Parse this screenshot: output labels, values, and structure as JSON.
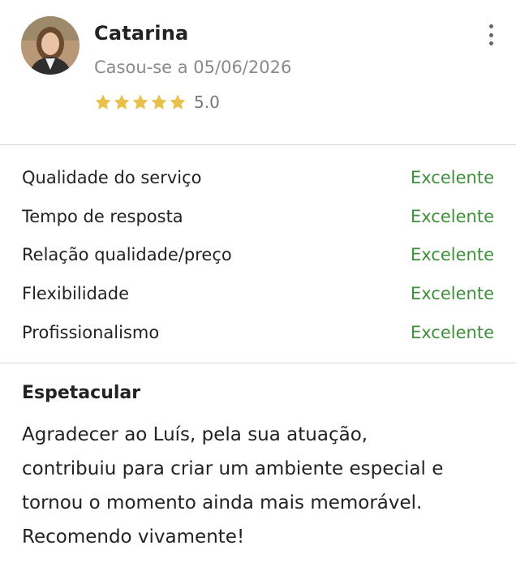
{
  "reviewer": {
    "name": "Catarina",
    "married_text": "Casou-se a 05/06/2026",
    "rating_value": "5.0",
    "stars": 5,
    "star_color": "#e8c04a"
  },
  "criteria": [
    {
      "label": "Qualidade do serviço",
      "value": "Excelente"
    },
    {
      "label": "Tempo de resposta",
      "value": "Excelente"
    },
    {
      "label": "Relação qualidade/preço",
      "value": "Excelente"
    },
    {
      "label": "Flexibilidade",
      "value": "Excelente"
    },
    {
      "label": "Profissionalismo",
      "value": "Excelente"
    }
  ],
  "review": {
    "title": "Espetacular",
    "body": "Agradecer ao Luís, pela sua atuação,\ncontribuiu para criar um ambiente especial e\ntornou o momento ainda mais memorável.\nRecomendo vivamente!"
  },
  "colors": {
    "accent_green": "#3f8f3a",
    "muted_text": "#8a8a8a"
  },
  "icons": {
    "more": "more-vertical-icon",
    "star": "star-icon"
  }
}
